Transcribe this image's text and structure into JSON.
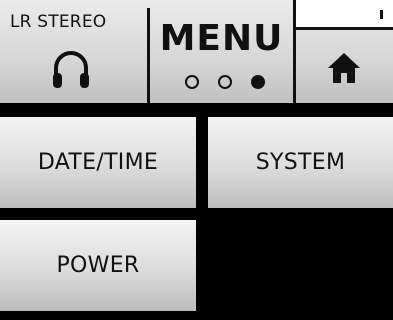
{
  "header": {
    "monitor_label": "LR STEREO",
    "monitor_icon": "headphone-icon",
    "title": "MENU",
    "page_dots": {
      "total": 3,
      "active": 3
    },
    "home_icon": "home-icon"
  },
  "buttons": {
    "date_time": "DATE/TIME",
    "system": "SYSTEM",
    "power": "POWER"
  },
  "colors": {
    "background": "#000000",
    "button_light": "#f4f4f4",
    "button_dark": "#bdbdbd",
    "text": "#111111"
  }
}
